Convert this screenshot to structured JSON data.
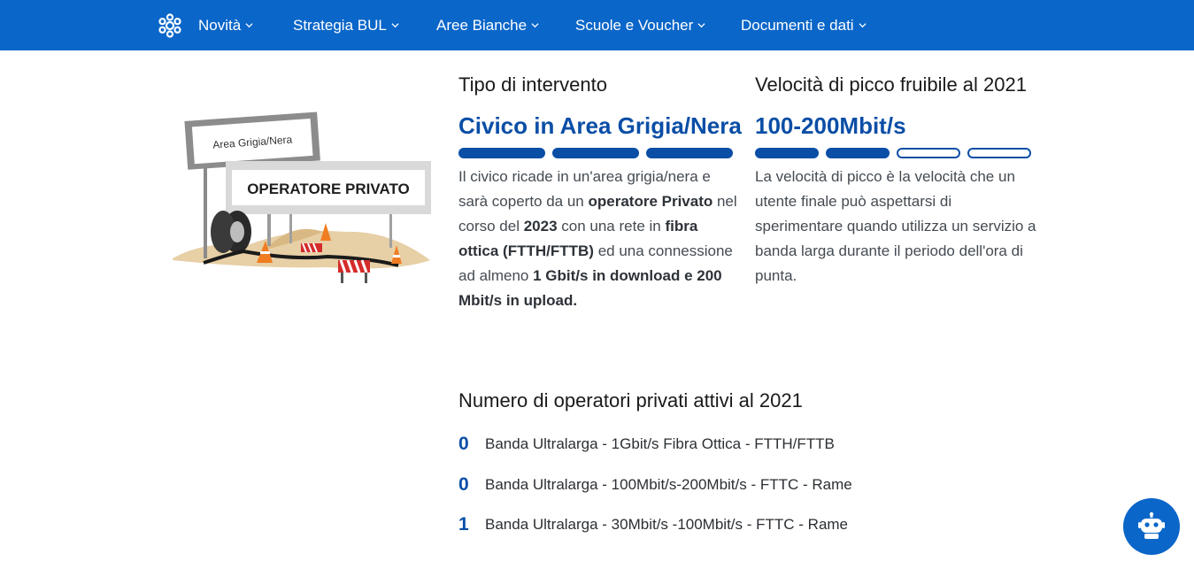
{
  "nav": {
    "items": [
      {
        "label": "Novità"
      },
      {
        "label": "Strategia BUL"
      },
      {
        "label": "Aree Bianche"
      },
      {
        "label": "Scuole e Voucher"
      },
      {
        "label": "Documenti e dati"
      }
    ]
  },
  "illustration": {
    "sign_top": "Area Grigia/Nera",
    "sign_main": "OPERATORE PRIVATO"
  },
  "intervention": {
    "title": "Tipo di intervento",
    "value": "Civico in Area Grigia/Nera",
    "level": {
      "filled": 3,
      "total": 3
    },
    "desc_parts": [
      {
        "t": "Il civico ricade in un'area grigia/nera e sarà coperto da un ",
        "b": false
      },
      {
        "t": "operatore Privato",
        "b": true
      },
      {
        "t": " nel corso del ",
        "b": false
      },
      {
        "t": "2023",
        "b": true
      },
      {
        "t": " con una rete in ",
        "b": false
      },
      {
        "t": "fibra ottica (FTTH/FTTB)",
        "b": true
      },
      {
        "t": " ed una connessione ad almeno ",
        "b": false
      },
      {
        "t": "1 Gbit/s in download e 200 Mbit/s in upload.",
        "b": true
      }
    ]
  },
  "speed": {
    "title": "Velocità di picco fruibile al 2021",
    "value": "100-200Mbit/s",
    "level": {
      "filled": 2,
      "total": 4
    },
    "desc": "La velocità di picco è la velocità che un utente finale può aspettarsi di sperimentare quando utilizza un servizio a banda larga durante il periodo dell'ora di punta."
  },
  "operators": {
    "title": "Numero di operatori privati attivi al 2021",
    "rows": [
      {
        "count": "0",
        "label": "Banda Ultralarga - 1Gbit/s Fibra Ottica - FTTH/FTTB"
      },
      {
        "count": "0",
        "label": "Banda Ultralarga - 100Mbit/s-200Mbit/s - FTTC - Rame"
      },
      {
        "count": "1",
        "label": "Banda Ultralarga - 30Mbit/s -100Mbit/s - FTTC - Rame"
      }
    ]
  },
  "colors": {
    "primary": "#0a66c9",
    "accent": "#0a4ea6"
  },
  "icons": {
    "logo": "network-logo-icon",
    "chevron": "chevron-down-icon",
    "chatbot": "robot-icon"
  }
}
